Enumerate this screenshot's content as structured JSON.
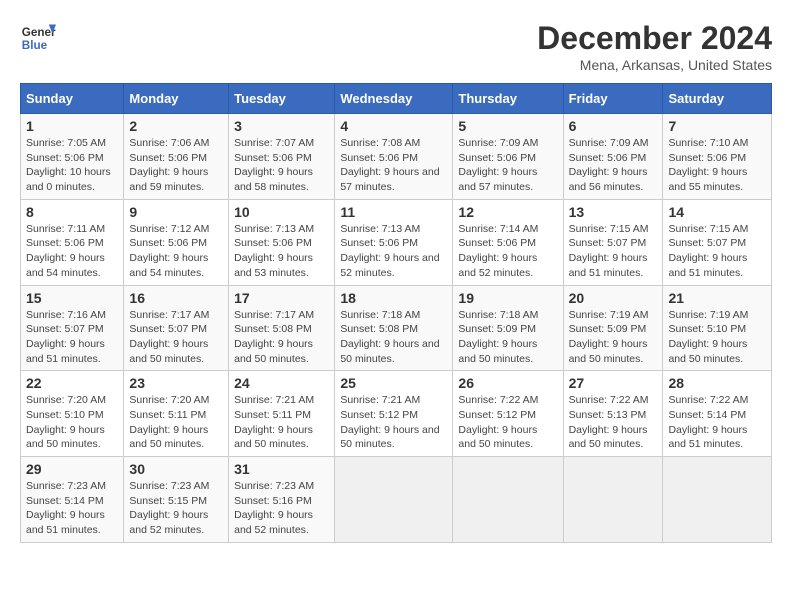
{
  "logo": {
    "line1": "General",
    "line2": "Blue"
  },
  "title": "December 2024",
  "subtitle": "Mena, Arkansas, United States",
  "days_of_week": [
    "Sunday",
    "Monday",
    "Tuesday",
    "Wednesday",
    "Thursday",
    "Friday",
    "Saturday"
  ],
  "weeks": [
    [
      {
        "day": "1",
        "sunrise": "7:05 AM",
        "sunset": "5:06 PM",
        "daylight": "10 hours and 0 minutes."
      },
      {
        "day": "2",
        "sunrise": "7:06 AM",
        "sunset": "5:06 PM",
        "daylight": "9 hours and 59 minutes."
      },
      {
        "day": "3",
        "sunrise": "7:07 AM",
        "sunset": "5:06 PM",
        "daylight": "9 hours and 58 minutes."
      },
      {
        "day": "4",
        "sunrise": "7:08 AM",
        "sunset": "5:06 PM",
        "daylight": "9 hours and 57 minutes."
      },
      {
        "day": "5",
        "sunrise": "7:09 AM",
        "sunset": "5:06 PM",
        "daylight": "9 hours and 57 minutes."
      },
      {
        "day": "6",
        "sunrise": "7:09 AM",
        "sunset": "5:06 PM",
        "daylight": "9 hours and 56 minutes."
      },
      {
        "day": "7",
        "sunrise": "7:10 AM",
        "sunset": "5:06 PM",
        "daylight": "9 hours and 55 minutes."
      }
    ],
    [
      {
        "day": "8",
        "sunrise": "7:11 AM",
        "sunset": "5:06 PM",
        "daylight": "9 hours and 54 minutes."
      },
      {
        "day": "9",
        "sunrise": "7:12 AM",
        "sunset": "5:06 PM",
        "daylight": "9 hours and 54 minutes."
      },
      {
        "day": "10",
        "sunrise": "7:13 AM",
        "sunset": "5:06 PM",
        "daylight": "9 hours and 53 minutes."
      },
      {
        "day": "11",
        "sunrise": "7:13 AM",
        "sunset": "5:06 PM",
        "daylight": "9 hours and 52 minutes."
      },
      {
        "day": "12",
        "sunrise": "7:14 AM",
        "sunset": "5:06 PM",
        "daylight": "9 hours and 52 minutes."
      },
      {
        "day": "13",
        "sunrise": "7:15 AM",
        "sunset": "5:07 PM",
        "daylight": "9 hours and 51 minutes."
      },
      {
        "day": "14",
        "sunrise": "7:15 AM",
        "sunset": "5:07 PM",
        "daylight": "9 hours and 51 minutes."
      }
    ],
    [
      {
        "day": "15",
        "sunrise": "7:16 AM",
        "sunset": "5:07 PM",
        "daylight": "9 hours and 51 minutes."
      },
      {
        "day": "16",
        "sunrise": "7:17 AM",
        "sunset": "5:07 PM",
        "daylight": "9 hours and 50 minutes."
      },
      {
        "day": "17",
        "sunrise": "7:17 AM",
        "sunset": "5:08 PM",
        "daylight": "9 hours and 50 minutes."
      },
      {
        "day": "18",
        "sunrise": "7:18 AM",
        "sunset": "5:08 PM",
        "daylight": "9 hours and 50 minutes."
      },
      {
        "day": "19",
        "sunrise": "7:18 AM",
        "sunset": "5:09 PM",
        "daylight": "9 hours and 50 minutes."
      },
      {
        "day": "20",
        "sunrise": "7:19 AM",
        "sunset": "5:09 PM",
        "daylight": "9 hours and 50 minutes."
      },
      {
        "day": "21",
        "sunrise": "7:19 AM",
        "sunset": "5:10 PM",
        "daylight": "9 hours and 50 minutes."
      }
    ],
    [
      {
        "day": "22",
        "sunrise": "7:20 AM",
        "sunset": "5:10 PM",
        "daylight": "9 hours and 50 minutes."
      },
      {
        "day": "23",
        "sunrise": "7:20 AM",
        "sunset": "5:11 PM",
        "daylight": "9 hours and 50 minutes."
      },
      {
        "day": "24",
        "sunrise": "7:21 AM",
        "sunset": "5:11 PM",
        "daylight": "9 hours and 50 minutes."
      },
      {
        "day": "25",
        "sunrise": "7:21 AM",
        "sunset": "5:12 PM",
        "daylight": "9 hours and 50 minutes."
      },
      {
        "day": "26",
        "sunrise": "7:22 AM",
        "sunset": "5:12 PM",
        "daylight": "9 hours and 50 minutes."
      },
      {
        "day": "27",
        "sunrise": "7:22 AM",
        "sunset": "5:13 PM",
        "daylight": "9 hours and 50 minutes."
      },
      {
        "day": "28",
        "sunrise": "7:22 AM",
        "sunset": "5:14 PM",
        "daylight": "9 hours and 51 minutes."
      }
    ],
    [
      {
        "day": "29",
        "sunrise": "7:23 AM",
        "sunset": "5:14 PM",
        "daylight": "9 hours and 51 minutes."
      },
      {
        "day": "30",
        "sunrise": "7:23 AM",
        "sunset": "5:15 PM",
        "daylight": "9 hours and 52 minutes."
      },
      {
        "day": "31",
        "sunrise": "7:23 AM",
        "sunset": "5:16 PM",
        "daylight": "9 hours and 52 minutes."
      },
      null,
      null,
      null,
      null
    ]
  ],
  "labels": {
    "sunrise": "Sunrise:",
    "sunset": "Sunset:",
    "daylight": "Daylight:"
  }
}
